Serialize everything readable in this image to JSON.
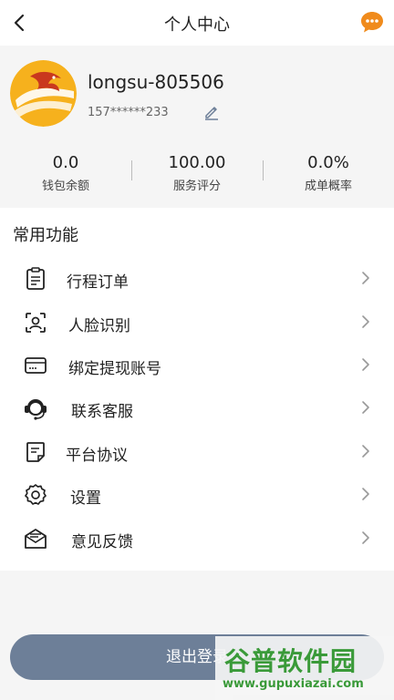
{
  "header": {
    "title": "个人中心"
  },
  "profile": {
    "username": "longsu-805506",
    "phone": "157******233"
  },
  "stats": [
    {
      "value": "0.0",
      "label": "钱包余额"
    },
    {
      "value": "100.00",
      "label": "服务评分"
    },
    {
      "value": "0.0%",
      "label": "成单概率"
    }
  ],
  "menu": {
    "title": "常用功能",
    "items": [
      {
        "label": "行程订单",
        "icon": "clipboard-icon"
      },
      {
        "label": "人脸识别",
        "icon": "face-scan-icon"
      },
      {
        "label": "绑定提现账号",
        "icon": "card-icon"
      },
      {
        "label": "联系客服",
        "icon": "headset-icon"
      },
      {
        "label": "平台协议",
        "icon": "document-icon"
      },
      {
        "label": "设置",
        "icon": "gear-icon"
      },
      {
        "label": "意见反馈",
        "icon": "mail-icon"
      }
    ]
  },
  "logout": {
    "label": "退出登录"
  },
  "watermark": {
    "brand": "谷普软件园",
    "url": "www.gupuxiazai.com"
  },
  "colors": {
    "accent": "#f08b1c",
    "logout_bg": "#6d7f98",
    "watermark": "#3a9a39"
  }
}
